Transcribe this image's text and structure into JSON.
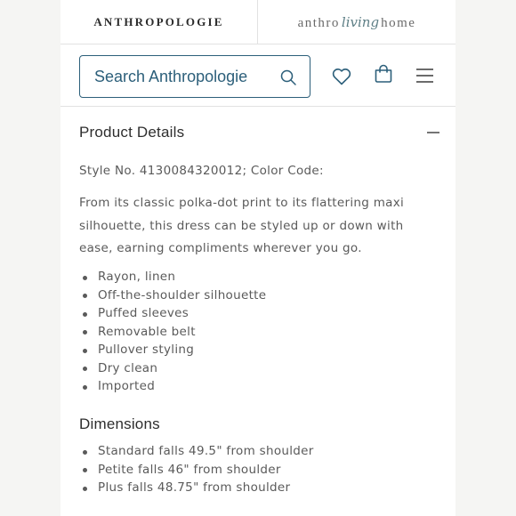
{
  "header": {
    "brand_left": "ANTHROPOLOGIE",
    "brand_right_prefix": "anthro",
    "brand_right_script": "living",
    "brand_right_suffix": "home"
  },
  "search": {
    "placeholder": "Search Anthropologie"
  },
  "icons": {
    "search": "search-icon",
    "wishlist": "heart-icon",
    "bag": "shopping-bag-icon",
    "menu": "hamburger-menu-icon",
    "collapse": "minus-icon"
  },
  "colors": {
    "accent": "#2c5f7a",
    "text": "#5a5a5a",
    "heading": "#2e2e2e"
  },
  "product_details": {
    "title": "Product Details",
    "style_line": "Style No. 4130084320012; Color Code:",
    "description": "From its classic polka-dot print to its flattering maxi silhouette, this dress can be styled up or down with ease, earning compliments wherever you go.",
    "features": [
      "Rayon, linen",
      "Off-the-shoulder silhouette",
      "Puffed sleeves",
      "Removable belt",
      "Pullover styling",
      "Dry clean",
      "Imported"
    ]
  },
  "dimensions": {
    "title": "Dimensions",
    "items": [
      "Standard falls 49.5\" from shoulder",
      "Petite falls 46\" from shoulder",
      "Plus falls 48.75\" from shoulder"
    ]
  }
}
